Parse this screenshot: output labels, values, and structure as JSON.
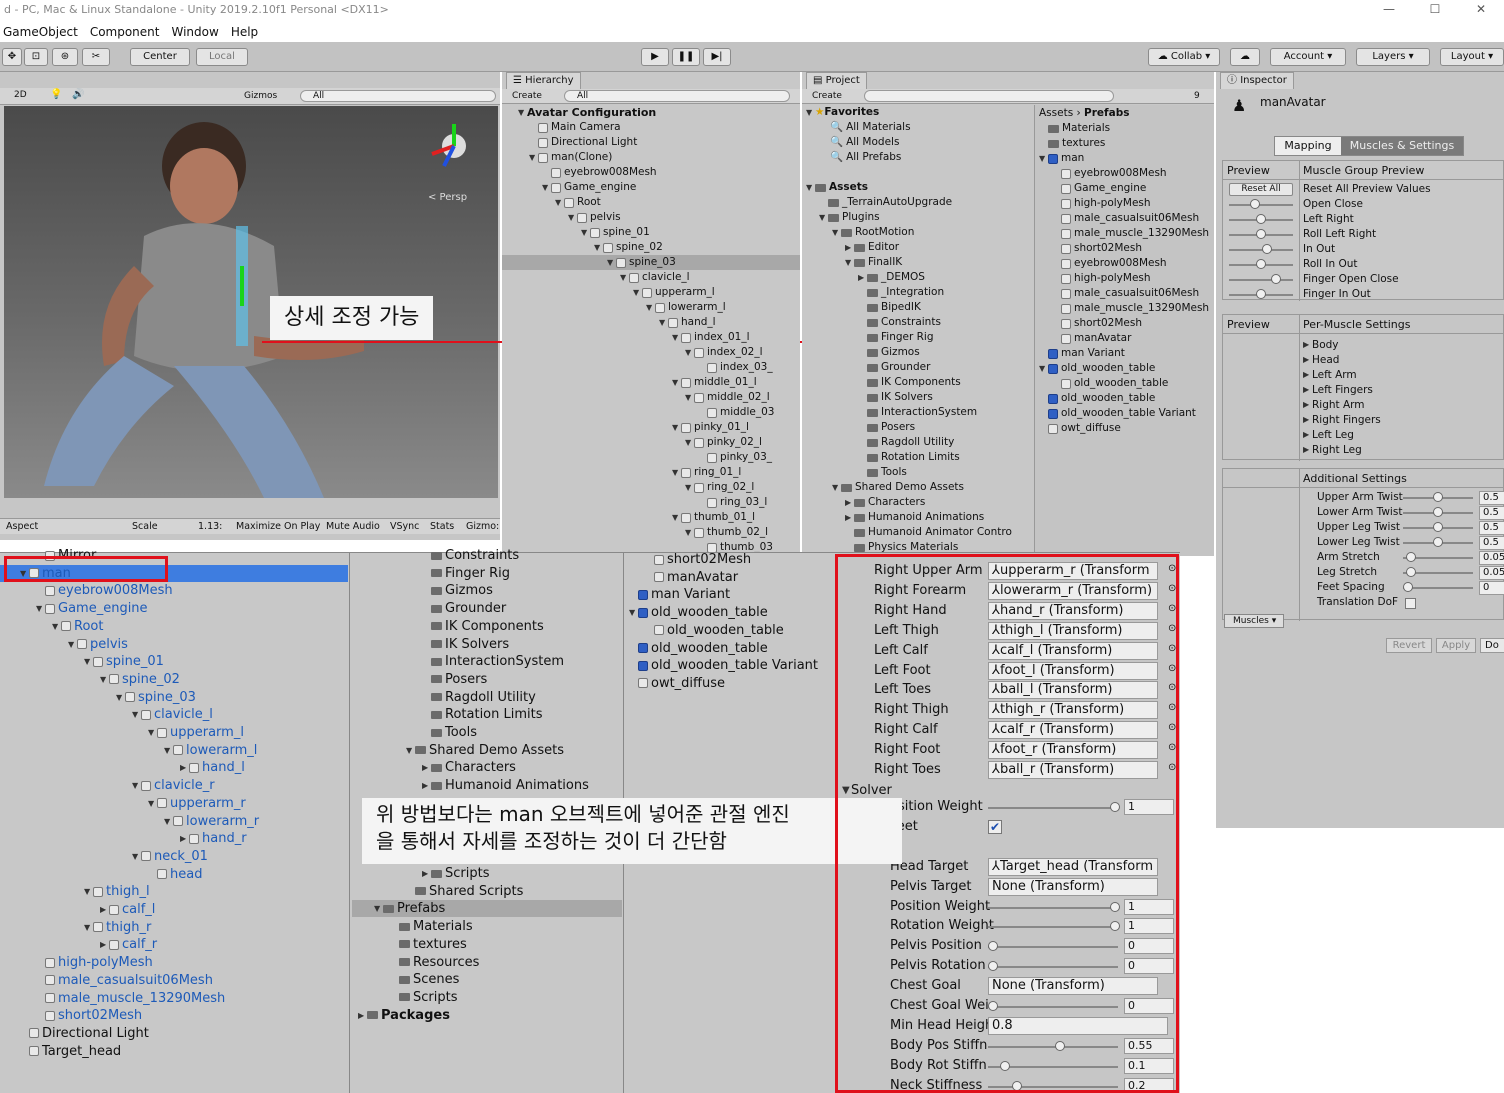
{
  "window": {
    "title": "d - PC, Mac & Linux Standalone - Unity 2019.2.10f1 Personal <DX11>"
  },
  "menu": [
    "GameObject",
    "Component",
    "Window",
    "Help"
  ],
  "toolbar": {
    "center": "Center",
    "local": "Local",
    "collab": "Collab",
    "account": "Account",
    "layers": "Layers",
    "layout": "Layout"
  },
  "scene": {
    "btn_2d": "2D",
    "gizmos": "Gizmos",
    "search": "All",
    "persp": "< Persp",
    "aspect": "Aspect",
    "scale": "Scale",
    "scale_val": "1.13:",
    "maximize": "Maximize On Play",
    "mute": "Mute Audio",
    "vsync": "VSync",
    "stats": "Stats",
    "gizmos2": "Gizmo:"
  },
  "callout1": "상세 조정 가능",
  "hierarchy": {
    "tab": "Hierarchy",
    "create": "Create",
    "search": "All",
    "root": "Avatar Configuration",
    "items": [
      "Main Camera",
      "Directional Light",
      "man(Clone)",
      "eyebrow008Mesh",
      "Game_engine",
      "Root",
      "pelvis",
      "spine_01",
      "spine_02",
      "spine_03",
      "clavicle_l",
      "upperarm_l",
      "lowerarm_l",
      "hand_l",
      "index_01_l",
      "index_02_l",
      "index_03_",
      "middle_01_l",
      "middle_02_l",
      "middle_03",
      "pinky_01_l",
      "pinky_02_l",
      "pinky_03_",
      "ring_01_l",
      "ring_02_l",
      "ring_03_l",
      "thumb_01_l",
      "thumb_02_l",
      "thumb_03"
    ]
  },
  "project": {
    "tab": "Project",
    "create": "Create",
    "count": "9",
    "favorites": "Favorites",
    "fav_items": [
      "All Materials",
      "All Models",
      "All Prefabs"
    ],
    "assets": "Assets",
    "tree": [
      "_TerrainAutoUpgrade",
      "Plugins",
      "RootMotion",
      "Editor",
      "FinalIK",
      "_DEMOS",
      "_Integration",
      "BipedIK",
      "Constraints",
      "Finger Rig",
      "Gizmos",
      "Grounder",
      "IK Components",
      "IK Solvers",
      "InteractionSystem",
      "Posers",
      "Ragdoll Utility",
      "Rotation Limits",
      "Tools",
      "Shared Demo Assets",
      "Characters",
      "Humanoid Animations",
      "Humanoid Animator Contro",
      "Physics Materials"
    ],
    "breadcrumb_a": "Assets",
    "breadcrumb_b": "Prefabs",
    "right": [
      "Materials",
      "textures",
      "man",
      "eyebrow008Mesh",
      "Game_engine",
      "high-polyMesh",
      "male_casualsuit06Mesh",
      "male_muscle_13290Mesh",
      "short02Mesh",
      "eyebrow008Mesh",
      "high-polyMesh",
      "male_casualsuit06Mesh",
      "male_muscle_13290Mesh",
      "short02Mesh",
      "manAvatar",
      "man Variant",
      "old_wooden_table",
      "old_wooden_table",
      "old_wooden_table",
      "old_wooden_table Variant",
      "owt_diffuse"
    ]
  },
  "inspector": {
    "tab": "Inspector",
    "name": "manAvatar",
    "mapping": "Mapping",
    "muscles": "Muscles & Settings",
    "preview": "Preview",
    "mgp": "Muscle Group Preview",
    "reset_all": "Reset All",
    "reset_values": "Reset All Preview Values",
    "groups": [
      "Open Close",
      "Left Right",
      "Roll Left Right",
      "In Out",
      "Roll In Out",
      "Finger Open Close",
      "Finger In Out"
    ],
    "preview2": "Preview",
    "per_muscle": "Per-Muscle Settings",
    "muscle_items": [
      "Body",
      "Head",
      "Left Arm",
      "Left Fingers",
      "Right Arm",
      "Right Fingers",
      "Left Leg",
      "Right Leg"
    ],
    "additional": "Additional Settings",
    "settings": [
      {
        "label": "Upper Arm Twist",
        "value": "0.5"
      },
      {
        "label": "Lower Arm Twist",
        "value": "0.5"
      },
      {
        "label": "Upper Leg Twist",
        "value": "0.5"
      },
      {
        "label": "Lower Leg Twist",
        "value": "0.5"
      },
      {
        "label": "Arm Stretch",
        "value": "0.05"
      },
      {
        "label": "Leg Stretch",
        "value": "0.05"
      },
      {
        "label": "Feet Spacing",
        "value": "0"
      },
      {
        "label": "Translation DoF",
        "value": ""
      }
    ],
    "muscles_dd": "Muscles",
    "revert": "Revert",
    "apply": "Apply",
    "done": "Do"
  },
  "big_hierarchy": [
    "Mirror",
    "man",
    "eyebrow008Mesh",
    "Game_engine",
    "Root",
    "pelvis",
    "spine_01",
    "spine_02",
    "spine_03",
    "clavicle_l",
    "upperarm_l",
    "lowerarm_l",
    "hand_l",
    "clavicle_r",
    "upperarm_r",
    "lowerarm_r",
    "hand_r",
    "neck_01",
    "head",
    "thigh_l",
    "calf_l",
    "thigh_r",
    "calf_r",
    "high-polyMesh",
    "male_casualsuit06Mesh",
    "male_muscle_13290Mesh",
    "short02Mesh",
    "Directional Light",
    "Target_head"
  ],
  "big_project": [
    "Constraints",
    "Finger Rig",
    "Gizmos",
    "Grounder",
    "IK Components",
    "IK Solvers",
    "InteractionSystem",
    "Posers",
    "Ragdoll Utility",
    "Rotation Limits",
    "Tools",
    "Shared Demo Assets",
    "Characters",
    "Humanoid Animations",
    "Scripts",
    "Shared Scripts",
    "Prefabs",
    "Materials",
    "textures",
    "Resources",
    "Scenes",
    "Scripts",
    "Packages"
  ],
  "big_assets": [
    "short02Mesh",
    "manAvatar",
    "man Variant",
    "old_wooden_table",
    "old_wooden_table",
    "old_wooden_table",
    "old_wooden_table Variant",
    "owt_diffuse"
  ],
  "callout2_line1": "위 방법보다는 man 오브젝트에 넣어준 관절 엔진",
  "callout2_line2": "을 통해서 자세를 조정하는 것이 더 간단함",
  "ik_refs": [
    {
      "label": "Right Upper Arm",
      "value": "upperarm_r (Transform"
    },
    {
      "label": "Right Forearm",
      "value": "lowerarm_r (Transform)"
    },
    {
      "label": "Right Hand",
      "value": "hand_r (Transform)"
    },
    {
      "label": "Left Thigh",
      "value": "thigh_l (Transform)"
    },
    {
      "label": "Left Calf",
      "value": "calf_l (Transform)"
    },
    {
      "label": "Left Foot",
      "value": "foot_l (Transform)"
    },
    {
      "label": "Left Toes",
      "value": "ball_l (Transform)"
    },
    {
      "label": "Right Thigh",
      "value": "thigh_r (Transform)"
    },
    {
      "label": "Right Calf",
      "value": "calf_r (Transform)"
    },
    {
      "label": "Right Foot",
      "value": "foot_r (Transform)"
    },
    {
      "label": "Right Toes",
      "value": "ball_r (Transform)"
    }
  ],
  "solver": "Solver",
  "solver_rows": [
    {
      "label": "osition Weight",
      "value": "1",
      "level": 1
    },
    {
      "label": "Feet",
      "value": "",
      "level": null
    },
    {
      "label": "e",
      "value": "",
      "level": null
    },
    {
      "label": "Head Target",
      "value": "Target_head (Transform",
      "level": null
    },
    {
      "label": "Pelvis Target",
      "value": "None (Transform)",
      "level": null
    },
    {
      "label": "Position Weight",
      "value": "1",
      "level": 1
    },
    {
      "label": "Rotation Weight",
      "value": "1",
      "level": 1
    },
    {
      "label": "Pelvis Position",
      "value": "0",
      "level": 0
    },
    {
      "label": "Pelvis Rotation",
      "value": "0",
      "level": 0
    },
    {
      "label": "Chest Goal",
      "value": "None (Transform)",
      "level": null
    },
    {
      "label": "Chest Goal Wei",
      "value": "0",
      "level": 0
    },
    {
      "label": "Min Head Heigh",
      "value": "0.8",
      "level": null
    },
    {
      "label": "Body Pos Stiffn",
      "value": "0.55",
      "level": 0.55
    },
    {
      "label": "Body Rot Stiffn",
      "value": "0.1",
      "level": 0.1
    },
    {
      "label": "Neck Stiffness",
      "value": "0.2",
      "level": 0.2
    }
  ]
}
